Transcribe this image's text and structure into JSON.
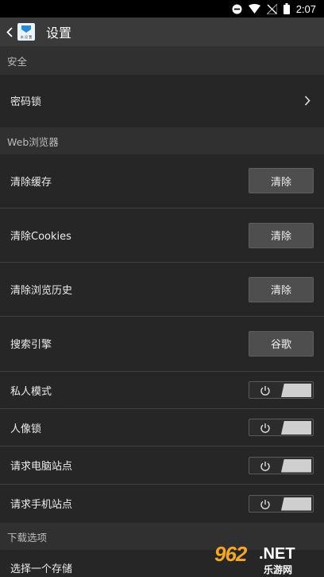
{
  "status_bar": {
    "time": "2:07"
  },
  "app_bar": {
    "title": "设置",
    "logo_text": "米 设 置"
  },
  "sections": {
    "security": {
      "header": "安全",
      "items": [
        {
          "label": "密码锁"
        }
      ]
    },
    "browser": {
      "header": "Web浏览器",
      "items": [
        {
          "label": "清除缓存",
          "button": "清除"
        },
        {
          "label": "清除Cookies",
          "button": "清除"
        },
        {
          "label": "清除浏览历史",
          "button": "清除"
        },
        {
          "label": "搜索引擎",
          "button": "谷歌"
        },
        {
          "label": "私人模式",
          "toggle": "on"
        },
        {
          "label": "人像锁",
          "toggle": "on"
        },
        {
          "label": "请求电脑站点",
          "toggle": "on"
        },
        {
          "label": "请求手机站点",
          "toggle": "on"
        }
      ]
    },
    "download": {
      "header": "下载选项",
      "items": [
        {
          "label": "选择一个存储"
        }
      ]
    }
  },
  "watermark": {
    "number": "962",
    "domain": ".NET",
    "sub": "乐游网"
  }
}
